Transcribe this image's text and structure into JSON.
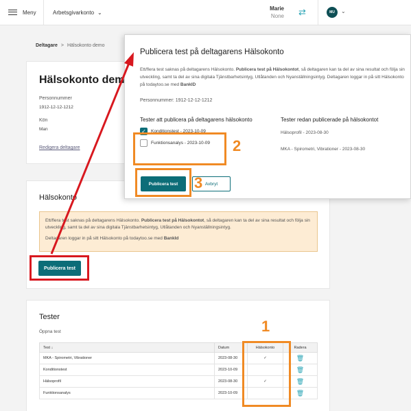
{
  "topbar": {
    "menu_label": "Meny",
    "portal_label": "Arbetsgivarkonto",
    "user_name": "Marie",
    "user_role": "None",
    "avatar_initials": "MU"
  },
  "breadcrumb": {
    "first": "Deltagare",
    "separator": ">",
    "current": "Hälsokonto demo"
  },
  "person_card": {
    "title": "Hälsokonto demo",
    "pnr_label": "Personnummer",
    "pnr_value": "1912-12-12-1212",
    "gender_label": "Kön",
    "gender_value": "Man",
    "edit_link": "Redigera deltagare"
  },
  "halso_card": {
    "title": "Hälsokonto",
    "warning_pre": "Ett/flera test saknas på deltagarens Hälsokonto. ",
    "warning_bold": "Publicera test på Hälsokontot",
    "warning_post": ", så deltagaren kan ta del av sina resultat och följa sin utveckling, samt ta del av sina digitala Tjänstbarhetsintyg, Utlåtanden och Nyanställningsintyg.",
    "warning2_pre": "Deltagaren loggar in på sitt Hälsokonto på todaytoo.se med ",
    "warning2_bold": "BankId",
    "button": "Publicera test"
  },
  "tester_card": {
    "title": "Tester",
    "open_test": "Öppna test",
    "columns": [
      "Test ↓",
      "Datum",
      "Hälsokonto",
      "Radera"
    ],
    "rows": [
      {
        "test": "MKA - Spirometri, Vibrationer",
        "date": "2023-08-30",
        "halsokonto": "✓"
      },
      {
        "test": "Konditionstest",
        "date": "2023-10-09",
        "halsokonto": ""
      },
      {
        "test": "Hälsoprofil",
        "date": "2023-08-30",
        "halsokonto": "✓"
      },
      {
        "test": "Funktionsanalys",
        "date": "2023-10-09",
        "halsokonto": ""
      }
    ]
  },
  "modal": {
    "title": "Publicera test på deltagarens Hälsokonto",
    "intro_pre": "Ett/flera test saknas på deltagarens Hälsokonto. ",
    "intro_bold": "Publicera test på Hälsokontot",
    "intro_post": ", så deltagaren kan ta del av sina resultat och följa sin utveckling, samt ta del av sina digitala Tjänstbarhetsintyg, Utlåtanden och Nyanställningsintyg. Deltagaren loggar in på sitt Hälsokonto på todaytoo.se med ",
    "intro_bold2": "BankID",
    "pnr": "Personnummer: 1912-12-12-1212",
    "left_heading": "Tester att publicera på deltagarens hälsokonto",
    "checkboxes": [
      {
        "label": "Konditionstest - 2023-10-09",
        "checked": true
      },
      {
        "label": "Funktionsanalys - 2023-10-09",
        "checked": false
      }
    ],
    "right_heading": "Tester redan publicerade på hälsokontot",
    "published": [
      "Hälsoprofil - 2023-08-30",
      "MKA - Spirometri, Vibrationer - 2023-08-30"
    ],
    "publish_button": "Publicera test",
    "cancel_button": "Avbryt"
  },
  "annotations": {
    "step1": "1",
    "step2": "2",
    "step3": "3"
  },
  "colors": {
    "accent": "#0c6d78",
    "highlight_red": "#d8181f",
    "highlight_orange": "#f08a24",
    "warning_bg": "#fdecd4"
  }
}
